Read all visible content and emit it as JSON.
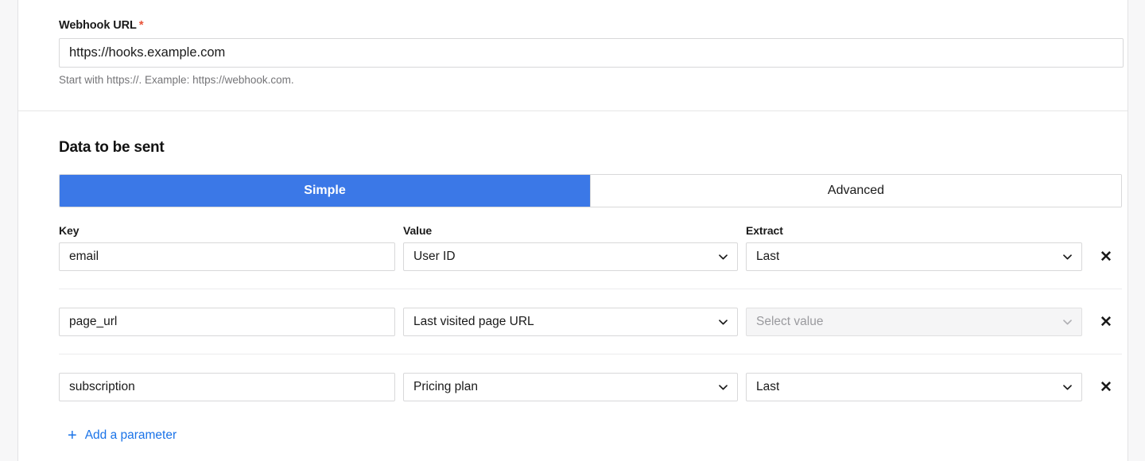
{
  "webhook": {
    "label": "Webhook URL",
    "required_marker": "*",
    "value": "https://hooks.example.com",
    "placeholder": "https://hooks.example.com",
    "help": "Start with https://. Example: https://webhook.com."
  },
  "data_section": {
    "title": "Data to be sent",
    "tabs": [
      {
        "label": "Simple",
        "active": true
      },
      {
        "label": "Advanced",
        "active": false
      }
    ],
    "columns": {
      "key": "Key",
      "value": "Value",
      "extract": "Extract"
    },
    "rows": [
      {
        "key": "email",
        "value": "User ID",
        "extract": "Last",
        "extract_disabled": false,
        "remove_icon": "✕"
      },
      {
        "key": "page_url",
        "value": "Last visited page URL",
        "extract": "Select value",
        "extract_disabled": true,
        "remove_icon": "✕"
      },
      {
        "key": "subscription",
        "value": "Pricing plan",
        "extract": "Last",
        "extract_disabled": false,
        "remove_icon": "✕"
      }
    ],
    "add_parameter": {
      "icon": "+",
      "label": "Add a parameter"
    }
  },
  "colors": {
    "accent": "#3b78e7",
    "link": "#1a73e8",
    "required": "#e8553b",
    "border": "#d8d8d9",
    "page_bg": "#f7f7f8"
  }
}
